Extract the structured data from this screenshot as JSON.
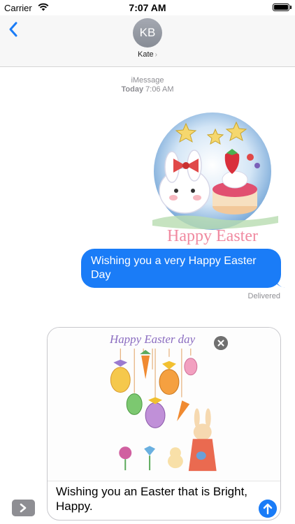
{
  "status": {
    "carrier": "Carrier",
    "time": "7:07 AM",
    "battery_level": 1.0
  },
  "header": {
    "avatar_initials": "KB",
    "contact_name": "Kate",
    "name_chevron": "›"
  },
  "thread": {
    "service": "iMessage",
    "timestamp_day": "Today",
    "timestamp_time": "7:06 AM",
    "sticker_caption": "Happy Easter",
    "outgoing_message": "Wishing you a very Happy Easter Day",
    "delivery_status": "Delivered"
  },
  "composer": {
    "attachment_title": "Happy Easter day",
    "text": "Wishing you an Easter that is Bright, Happy."
  },
  "colors": {
    "bubble_blue": "#1a7cf7",
    "header_bg": "#f7f7f7",
    "meta_gray": "#8e8e93"
  },
  "icons": {
    "back": "chevron-left-icon",
    "wifi": "wifi-icon",
    "battery": "battery-icon",
    "apps": "chevron-right-icon",
    "send": "arrow-up-icon",
    "remove": "close-icon"
  }
}
